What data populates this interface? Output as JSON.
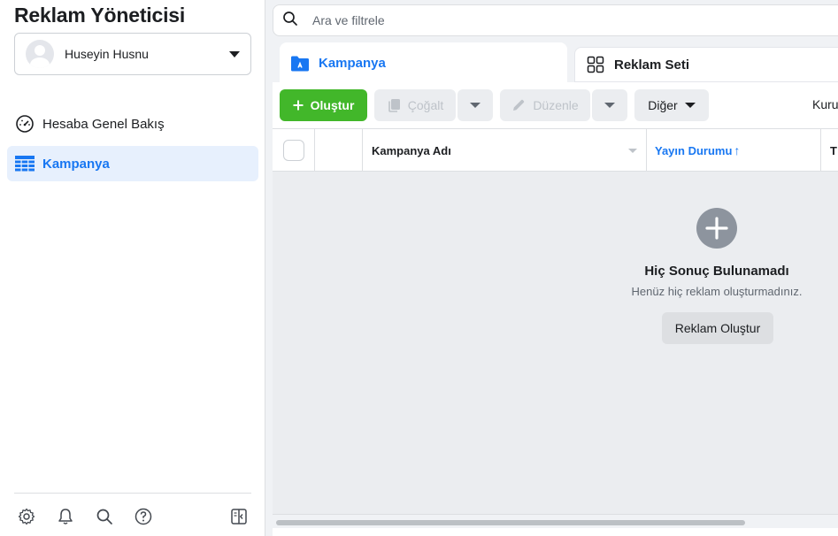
{
  "sidebar": {
    "title": "Reklam Yöneticisi",
    "account_name": "Huseyin Husnu",
    "nav": [
      {
        "label": "Hesaba Genel Bakış",
        "icon": "gauge-icon"
      },
      {
        "label": "Kampanya",
        "icon": "table-grid-icon"
      }
    ],
    "footer_icons": [
      "gear-icon",
      "bell-icon",
      "search-icon",
      "help-icon",
      "panel-toggle-icon"
    ]
  },
  "search": {
    "placeholder": "Ara ve filtrele"
  },
  "tabs": [
    {
      "label": "Kampanya",
      "icon": "folder-icon",
      "active": true
    },
    {
      "label": "Reklam Seti",
      "icon": "grid-icon",
      "active": false
    }
  ],
  "toolbar": {
    "create_label": "Oluştur",
    "duplicate_label": "Çoğalt",
    "edit_label": "Düzenle",
    "more_label": "Diğer",
    "setup_label": "Kuru"
  },
  "table": {
    "columns": [
      "Kampanya Adı",
      "Yayın Durumu",
      "T"
    ],
    "status_sort": "↑"
  },
  "empty_state": {
    "title": "Hiç Sonuç Bulunamadı",
    "subtitle": "Henüz hiç reklam oluşturmadınız.",
    "button_label": "Reklam Oluştur"
  },
  "colors": {
    "brand_blue": "#1877f2",
    "create_green": "#42b72a"
  }
}
